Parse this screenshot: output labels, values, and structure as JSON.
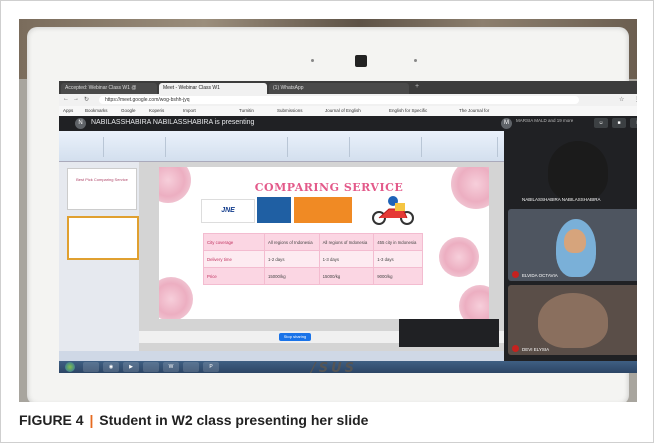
{
  "caption": {
    "label": "FIGURE 4",
    "separator": "|",
    "text": "Student in W2 class presenting her slide"
  },
  "browser": {
    "tabs": [
      "Accepted: Webinar Class W1 @",
      "Meet - Webinar Class W1",
      "(1) WhatsApp"
    ],
    "url": "https://meet.google.com/wog-bshh-jyq",
    "bookmarks": [
      "Apps",
      "Bookmarks",
      "Google",
      "Koperis",
      "Import",
      "Turnitin",
      "Submissions",
      "Journal of English",
      "English for Specific",
      "The Journal for"
    ]
  },
  "meet": {
    "presenter_avatar": "N",
    "presenting_text": "NABILASSHABIRA NABILASSHABIRA is presenting",
    "participant_avatar": "M",
    "participants_text": "MARSIA MALD and 19 more",
    "tiles": [
      {
        "name": "NABILASSHABIRA NABILASSHABIRA"
      },
      {
        "name": "ELVIDA OCTAVIA"
      },
      {
        "name": "DEVI ELYSIA"
      }
    ]
  },
  "slide": {
    "title": "COMPARING SERVICE",
    "logo_text": "JNE",
    "table": [
      [
        "City coverage",
        "All regions of Indonesia",
        "All regions of Indonesia",
        "455 city in Indonesia"
      ],
      [
        "Delivery time",
        "1-2 days",
        "1-3 days",
        "1-3 days"
      ],
      [
        "Price",
        "15000/kg",
        "15000/kg",
        "9000/kg"
      ]
    ],
    "thumb_title": "Best Pick Comparing Service",
    "stop_label": "Stop sharing"
  },
  "laptop": {
    "brand": "/SUS"
  },
  "colors": {
    "accent": "#e66a1f",
    "slide_title": "#e35a8a",
    "meet_bg": "#202124"
  }
}
